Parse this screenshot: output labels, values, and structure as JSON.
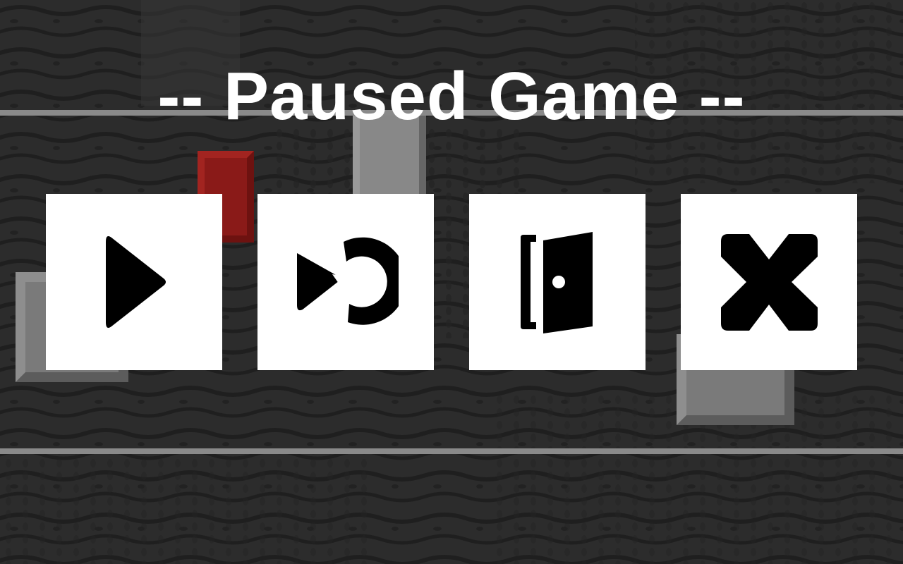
{
  "pause_menu": {
    "title": "-- Paused Game --",
    "buttons": [
      {
        "id": "resume",
        "icon": "play-icon"
      },
      {
        "id": "restart",
        "icon": "restart-icon"
      },
      {
        "id": "exit",
        "icon": "exit-door-icon"
      },
      {
        "id": "quit",
        "icon": "close-icon"
      }
    ]
  },
  "colors": {
    "background": "#2b2b2b",
    "rail": "#8a8a8a",
    "button_bg": "#ffffff",
    "icon": "#000000",
    "title": "#ffffff",
    "red_block": "#8a1a18",
    "gray_block": "#7a7a7a"
  }
}
